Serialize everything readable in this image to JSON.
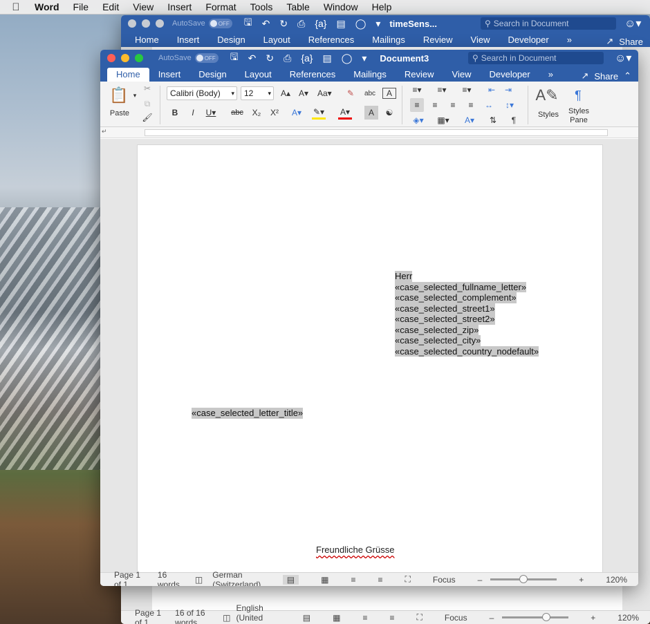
{
  "menubar": {
    "app_name": "Word",
    "items": [
      "File",
      "Edit",
      "View",
      "Insert",
      "Format",
      "Tools",
      "Table",
      "Window",
      "Help"
    ]
  },
  "back_window": {
    "autosave_label": "AutoSave",
    "autosave_state": "OFF",
    "doc_title": "timeSens...",
    "search_placeholder": "Search in Document",
    "tabs": [
      "Home",
      "Insert",
      "Design",
      "Layout",
      "References",
      "Mailings",
      "Review",
      "View",
      "Developer"
    ],
    "share_label": "Share",
    "status": {
      "page": "Page 1 of 1",
      "words": "16 of 16 words",
      "language": "English (United States)",
      "focus": "Focus",
      "zoom": "120%"
    }
  },
  "front_window": {
    "autosave_label": "AutoSave",
    "autosave_state": "OFF",
    "doc_title": "Document3",
    "search_placeholder": "Search in Document",
    "tabs": [
      "Home",
      "Insert",
      "Design",
      "Layout",
      "References",
      "Mailings",
      "Review",
      "View",
      "Developer"
    ],
    "active_tab": "Home",
    "share_label": "Share",
    "ribbon": {
      "paste_label": "Paste",
      "font_name": "Calibri (Body)",
      "font_size": "12",
      "styles_label": "Styles",
      "styles_pane_label_1": "Styles",
      "styles_pane_label_2": "Pane"
    },
    "document": {
      "address_lines": [
        "Herr",
        "«case_selected_fullname_letter»",
        "«case_selected_complement»",
        "«case_selected_street1»",
        "«case_selected_street2»",
        "«case_selected_zip»",
        "«case_selected_city»",
        "«case_selected_country_nodefault»"
      ],
      "letter_title": "«case_selected_letter_title»",
      "greeting": "Freundliche Grüsse"
    },
    "status": {
      "page": "Page 1 of 1",
      "words": "16 words",
      "language": "German (Switzerland)",
      "focus": "Focus",
      "zoom": "120%",
      "zoom_fraction": 0.5
    }
  },
  "colors": {
    "ribbon_blue": "#2f5ea8",
    "close": "#fc5f57",
    "minimize": "#fdbc2e",
    "zoom": "#28c840"
  }
}
